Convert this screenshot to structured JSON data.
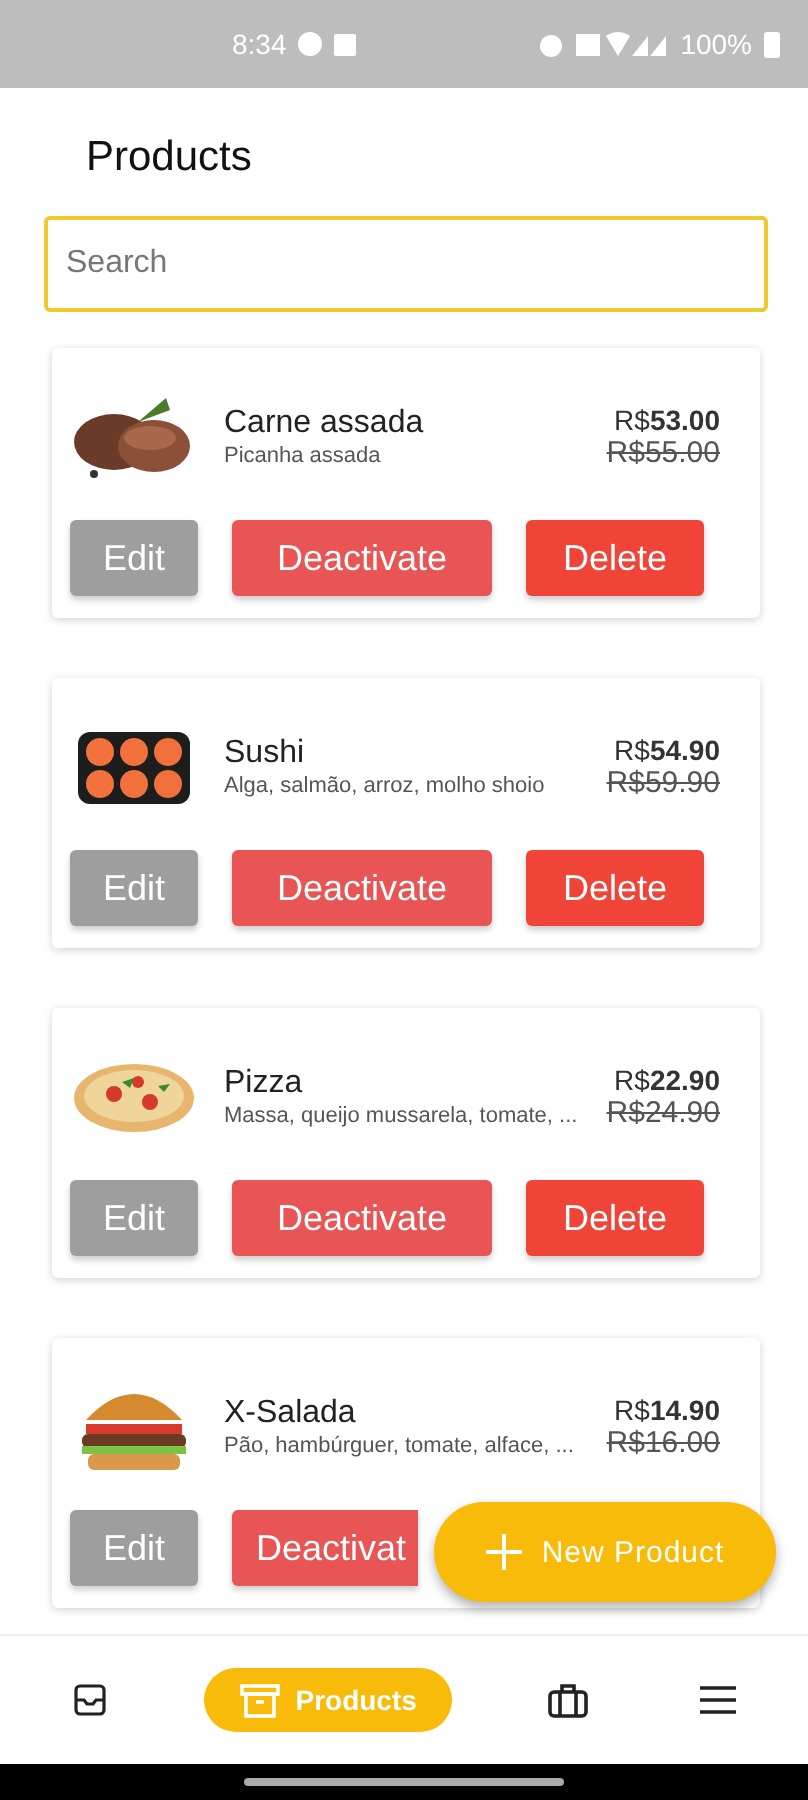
{
  "status_bar": {
    "time": "8:34",
    "battery": "100%"
  },
  "header": {
    "title": "Products"
  },
  "search": {
    "placeholder": "Search"
  },
  "products": [
    {
      "name": "Carne assada",
      "description": "Picanha assada",
      "price": "R$**53.00**",
      "old_price": "R$55.00",
      "buttons": [
        {
          "kind": "edit",
          "label": "Edit"
        },
        {
          "kind": "deactivate",
          "label": "Deactivate"
        },
        {
          "kind": "delete",
          "label": "Delete"
        }
      ]
    },
    {
      "name": "Sushi",
      "description": "Alga, salmão, arroz, molho shoio",
      "price": "R$**54.90**",
      "old_price": "R$59.90",
      "buttons": [
        {
          "kind": "edit",
          "label": "Edit"
        },
        {
          "kind": "deactivate",
          "label": "Deactivate"
        },
        {
          "kind": "delete",
          "label": "Delete"
        }
      ]
    },
    {
      "name": "Pizza",
      "description": "Massa, queijo mussarela, tomate, ...",
      "price": "R$**22.90**",
      "old_price": "R$24.90",
      "buttons": [
        {
          "kind": "edit",
          "label": "Edit"
        },
        {
          "kind": "deactivate",
          "label": "Deactivate"
        },
        {
          "kind": "delete",
          "label": "Delete"
        }
      ]
    },
    {
      "name": "X-Salada",
      "description": "Pão, hambúrguer, tomate, alface, ...",
      "price": "R$**14.90**",
      "old_price": "R$16.00",
      "buttons": [
        {
          "kind": "edit",
          "label": "Edit"
        },
        {
          "kind": "deactivate",
          "label": "Deactivat"
        }
      ]
    }
  ],
  "fab": {
    "label": "New Product"
  },
  "nav": [
    {
      "selected": false
    },
    {
      "label": "Products",
      "selected": true
    },
    {
      "selected": false
    },
    {
      "selected": false
    }
  ]
}
